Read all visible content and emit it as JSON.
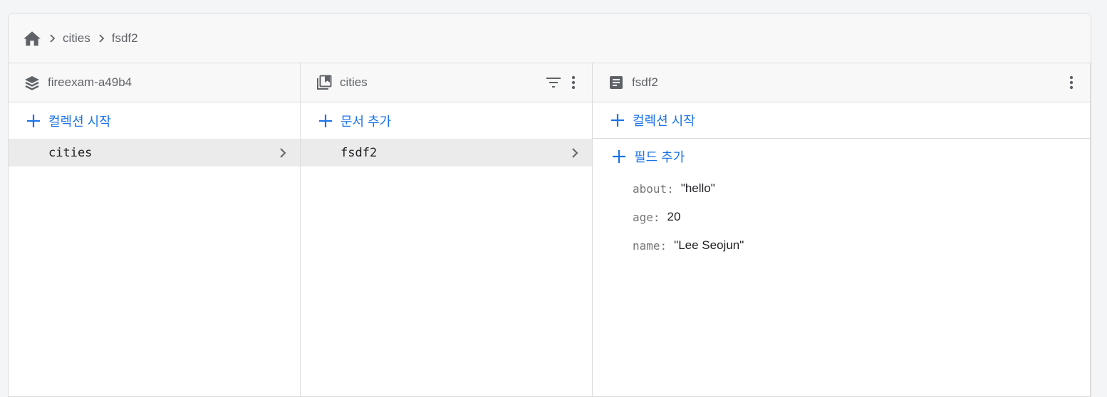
{
  "breadcrumb": {
    "items": [
      "cities",
      "fsdf2"
    ]
  },
  "columns": {
    "root": {
      "title": "fireexam-a49b4",
      "add_label": "컬렉션 시작",
      "items": [
        {
          "label": "cities"
        }
      ]
    },
    "collection": {
      "title": "cities",
      "add_label": "문서 추가",
      "items": [
        {
          "label": "fsdf2"
        }
      ]
    },
    "document": {
      "title": "fsdf2",
      "add_collection_label": "컬렉션 시작",
      "add_field_label": "필드 추가",
      "fields": [
        {
          "key": "about",
          "value": "\"hello\""
        },
        {
          "key": "age",
          "value": "20"
        },
        {
          "key": "name",
          "value": "\"Lee Seojun\""
        }
      ]
    }
  },
  "colors": {
    "accent": "#1a73e8",
    "icon": "#5f6368",
    "selected_bg": "#ebebeb"
  },
  "icons": {
    "home": "home-icon",
    "separator": "chevron-right-icon",
    "project": "layers-icon",
    "collection": "collection-icon",
    "document": "document-icon",
    "filter": "filter-icon",
    "more": "more-vert-icon",
    "add": "plus-icon"
  }
}
